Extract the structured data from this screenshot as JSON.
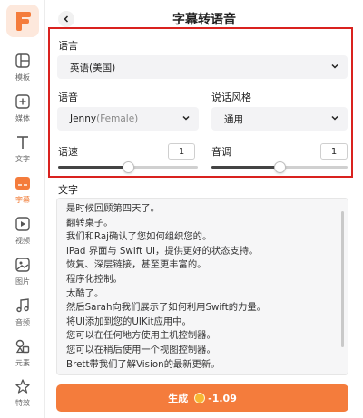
{
  "sidebar": {
    "logo_letter": "F",
    "items": [
      {
        "label": "模板",
        "icon": "template-icon"
      },
      {
        "label": "媒体",
        "icon": "media-add-icon"
      },
      {
        "label": "文字",
        "icon": "text-icon"
      },
      {
        "label": "字幕",
        "icon": "subtitle-icon",
        "active": true
      },
      {
        "label": "视频",
        "icon": "video-icon"
      },
      {
        "label": "图片",
        "icon": "image-icon"
      },
      {
        "label": "音频",
        "icon": "audio-icon"
      },
      {
        "label": "元素",
        "icon": "elements-icon"
      },
      {
        "label": "特效",
        "icon": "effects-icon"
      }
    ]
  },
  "header": {
    "title": "字幕转语音"
  },
  "settings": {
    "language_label": "语言",
    "language_value": "英语(美国)",
    "voice_label": "语音",
    "voice_name": "Jenny",
    "voice_gender": "(Female)",
    "style_label": "说话风格",
    "style_value": "通用",
    "speed_label": "语速",
    "speed_value": "1",
    "speed_level": 0.5,
    "pitch_label": "音调",
    "pitch_value": "1",
    "pitch_level": 0.5
  },
  "text_section": {
    "label": "文字",
    "lines": [
      "是时候回顾第四天了。",
      "翻转桌子。",
      "我们和Raj确认了您如何组织您的。",
      "iPad 界面与 Swift UI，提供更好的状态支持。",
      "恢复、深层链接，甚至更丰富的。",
      "程序化控制。",
      "太酷了。",
      "然后Sarah向我们展示了如何利用Swift的力量。",
      "将UI添加到您的UIKit应用中。",
      "您可以在任何地方使用主机控制器。",
      "您可以在稍后使用一个视图控制器。",
      "Brett带我们了解Vision的最新更新。"
    ]
  },
  "generate": {
    "label": "生成",
    "cost": "-1.09"
  },
  "colors": {
    "accent": "#f47c3c",
    "highlight": "#d9221f"
  }
}
